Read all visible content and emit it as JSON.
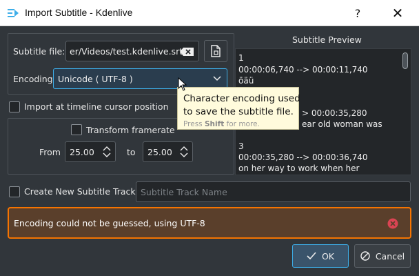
{
  "window": {
    "title": "Import Subtitle - Kdenlive",
    "help_label": "?",
    "close_label": "✕"
  },
  "file": {
    "label": "Subtitle file:",
    "value": "er/Videos/test.kdenlive.srt"
  },
  "encoding": {
    "label": "Encoding",
    "value": "Unicode ( UTF-8 )"
  },
  "tooltip": {
    "line1": "Character encoding used",
    "line2": "to save the subtitle file.",
    "hint_prefix": "Press ",
    "hint_key": "Shift",
    "hint_suffix": " for more."
  },
  "timeline_cursor": {
    "label": "Import at timeline cursor position",
    "checked": false
  },
  "framerate": {
    "label": "Transform framerate",
    "checked": false,
    "from_label": "From",
    "from_value": "25.00",
    "to_label": "to",
    "to_value": "25.00"
  },
  "preview": {
    "title": "Subtitle Preview",
    "lines": [
      "1",
      "00:00:06,740 --> 00:00:11,740",
      "öäü",
      "",
      "> 00:00:35,280",
      "ear old woman was",
      "",
      "3",
      "00:00:35,280 --> 00:00:36,740",
      "on her way to work when her"
    ]
  },
  "new_track": {
    "label": "Create New Subtitle Track",
    "checked": false,
    "placeholder": "Subtitle Track Name"
  },
  "warning": {
    "message": "Encoding could not be guessed, using UTF-8"
  },
  "buttons": {
    "ok_label": "OK",
    "cancel_label": "Cancel"
  },
  "colors": {
    "background": "#31363b",
    "accent": "#3daee9",
    "warning_border": "#f67400",
    "warning_bg": "#5a3f2b",
    "error_icon": "#da4453",
    "tooltip_bg": "#fffbdc"
  }
}
